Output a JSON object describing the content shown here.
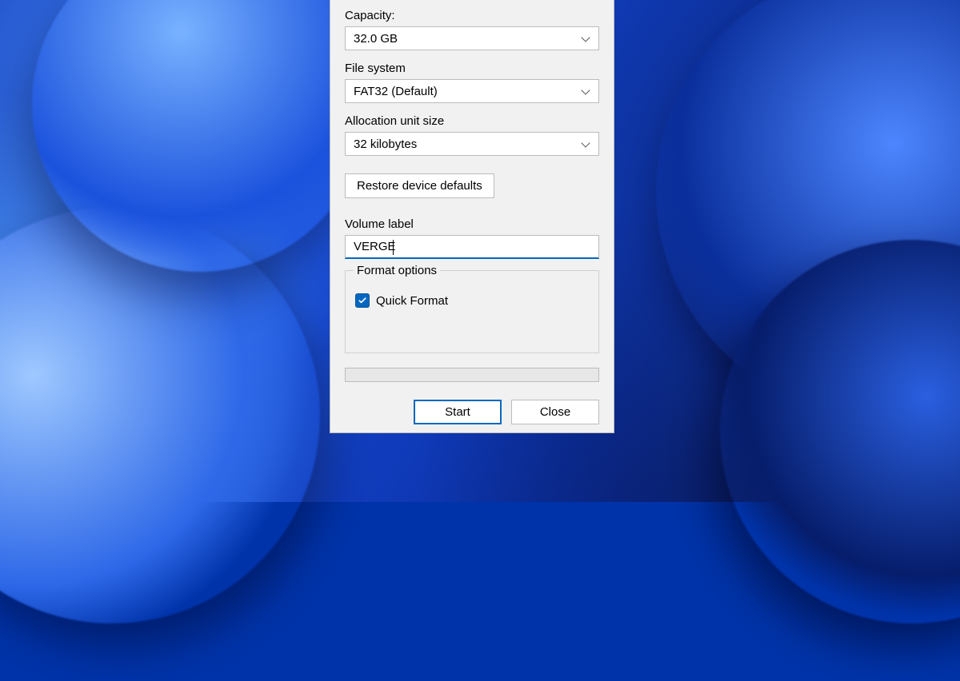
{
  "capacity": {
    "label": "Capacity:",
    "value": "32.0 GB"
  },
  "filesystem": {
    "label": "File system",
    "value": "FAT32 (Default)"
  },
  "allocation": {
    "label": "Allocation unit size",
    "value": "32 kilobytes"
  },
  "restore_button": "Restore device defaults",
  "volume": {
    "label": "Volume label",
    "value": "VERGE"
  },
  "options": {
    "group_label": "Format options",
    "quick_format": {
      "label": "Quick Format",
      "checked": true
    }
  },
  "actions": {
    "start": "Start",
    "close": "Close"
  },
  "colors": {
    "accent": "#0067c0"
  }
}
